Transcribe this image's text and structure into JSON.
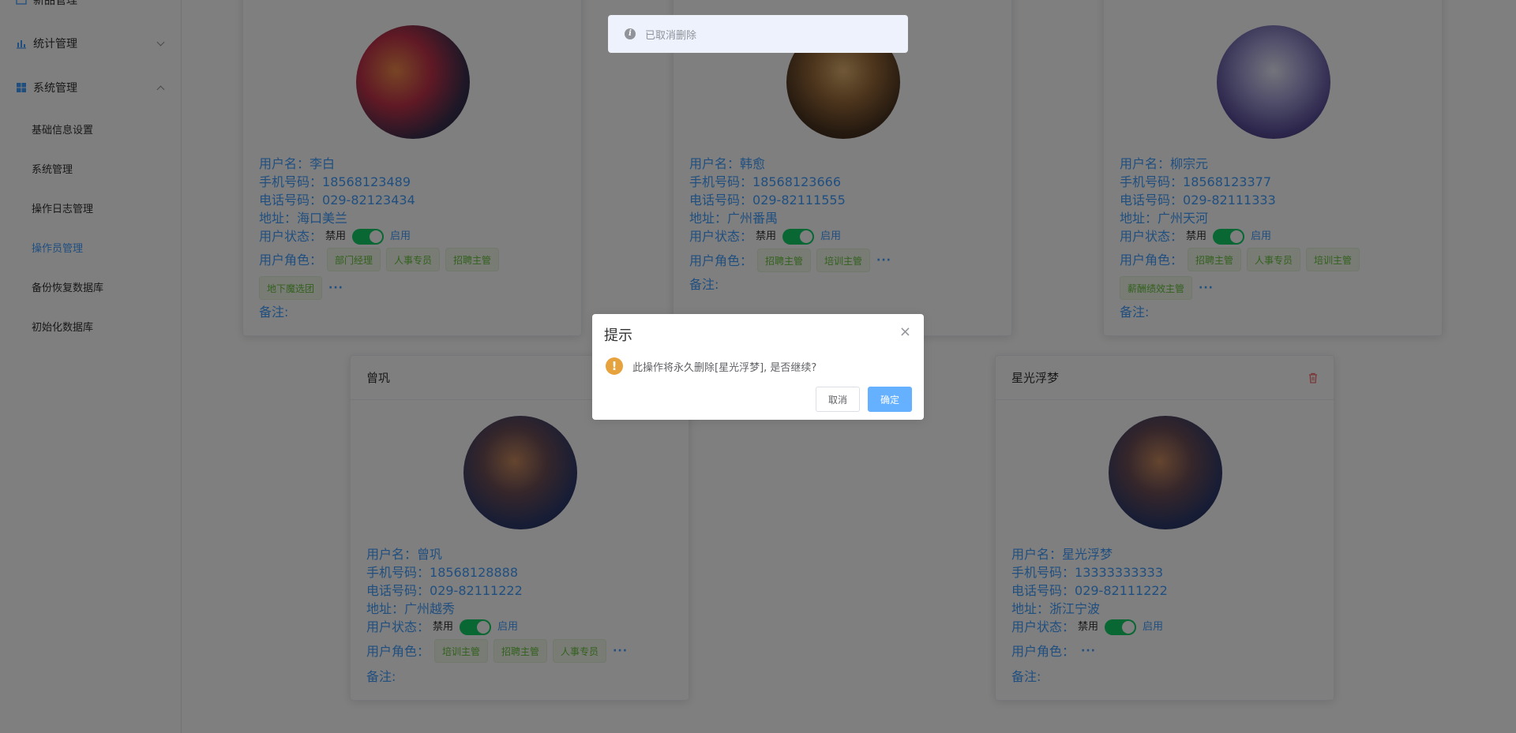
{
  "sidebar": {
    "partial_top_label": "新品管理",
    "items": [
      {
        "label": "统计管理",
        "expanded": false
      },
      {
        "label": "系统管理",
        "expanded": true
      }
    ],
    "subitems": [
      {
        "label": "基础信息设置",
        "active": false
      },
      {
        "label": "系统管理",
        "active": false
      },
      {
        "label": "操作日志管理",
        "active": false
      },
      {
        "label": "操作员管理",
        "active": true
      },
      {
        "label": "备份恢复数据库",
        "active": false
      },
      {
        "label": "初始化数据库",
        "active": false
      }
    ]
  },
  "labels": {
    "username": "用户名：",
    "mobile": "手机号码：",
    "phone": "电话号码：",
    "address": "地址：",
    "status": "用户状态：",
    "status_off": "禁用",
    "status_on": "启用",
    "roles": "用户角色：",
    "remark": "备注:",
    "more": "···"
  },
  "users": [
    {
      "name": "李白",
      "mobile": "18568123489",
      "phone": "029-82123434",
      "address": "海口美兰",
      "enabled": true,
      "roles": [
        "部门经理",
        "人事专员",
        "招聘主管",
        "地下魔选团"
      ],
      "header": ""
    },
    {
      "name": "韩愈",
      "mobile": "18568123666",
      "phone": "029-82111555",
      "address": "广州番禺",
      "enabled": true,
      "roles": [
        "招聘主管",
        "培训主管"
      ],
      "header": ""
    },
    {
      "name": "柳宗元",
      "mobile": "18568123377",
      "phone": "029-82111333",
      "address": "广州天河",
      "enabled": true,
      "roles": [
        "招聘主管",
        "人事专员",
        "培训主管",
        "薪酬绩效主管"
      ],
      "header": ""
    },
    {
      "name": "曾巩",
      "mobile": "18568128888",
      "phone": "029-82111222",
      "address": "广州越秀",
      "enabled": true,
      "roles": [
        "培训主管",
        "招聘主管",
        "人事专员"
      ],
      "header": "曾巩"
    },
    {
      "name": "星光浮梦",
      "mobile": "13333333333",
      "phone": "029-82111222",
      "address": "浙江宁波",
      "enabled": true,
      "roles": [],
      "header": "星光浮梦"
    }
  ],
  "toast": {
    "text": "已取消删除",
    "icon": "info-icon"
  },
  "dialog": {
    "title": "提示",
    "message": "此操作将永久删除[星光浮梦], 是否继续?",
    "cancel": "取消",
    "confirm": "确定",
    "icon": "warning-icon"
  },
  "colors": {
    "primary": "#409EFF",
    "switch_on": "#13ce66",
    "tag_text": "#67c23a",
    "warning": "#e6a23c",
    "danger": "#f56c6c"
  }
}
